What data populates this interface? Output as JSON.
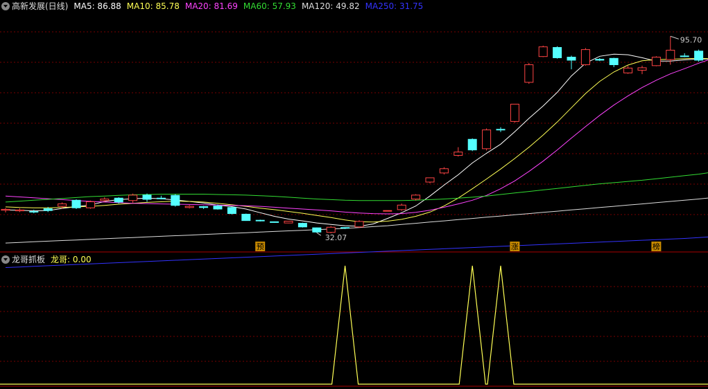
{
  "main_panel": {
    "title": "高新发展(日线)",
    "ma_legend": [
      {
        "label": "MA5: 86.88",
        "color": "#ffffff"
      },
      {
        "label": "MA10: 85.78",
        "color": "#ffff55"
      },
      {
        "label": "MA20: 81.69",
        "color": "#ff44ff"
      },
      {
        "label": "MA60: 57.93",
        "color": "#33dd33"
      },
      {
        "label": "MA120: 49.82",
        "color": "#dddddd"
      },
      {
        "label": "MA250: 31.75",
        "color": "#3333ff"
      }
    ],
    "high_label": "95.70",
    "low_label": "32.07",
    "markers": [
      "预",
      "涨",
      "榜"
    ]
  },
  "indicator_panel": {
    "title": "龙哥抓板",
    "value_label": "龙哥: 0.00"
  },
  "colors": {
    "up": "#ff4444",
    "down": "#55ffff",
    "grid": "#7a0000",
    "indicator_line": "#ffff55",
    "marker_bg": "#c88a00"
  },
  "chart_data": {
    "type": "candlestick",
    "price_range": [
      25,
      104
    ],
    "candles": [
      [
        38.3,
        38.6,
        37.6,
        39.0
      ],
      [
        38.1,
        38.4,
        37.7,
        38.9
      ],
      [
        37.9,
        37.8,
        37.3,
        38.5
      ],
      [
        38.8,
        38.2,
        37.7,
        39.4
      ],
      [
        39.6,
        40.4,
        38.8,
        40.9
      ],
      [
        41.6,
        39.1,
        38.7,
        41.9
      ],
      [
        39.1,
        41.1,
        38.8,
        41.5
      ],
      [
        41.5,
        42.0,
        41.1,
        42.6
      ],
      [
        42.3,
        41.0,
        40.5,
        42.6
      ],
      [
        41.5,
        43.3,
        40.8,
        43.8
      ],
      [
        43.3,
        41.9,
        41.1,
        43.8
      ],
      [
        42.3,
        42.2,
        41.9,
        43.1
      ],
      [
        43.2,
        39.9,
        39.5,
        43.6
      ],
      [
        39.2,
        39.6,
        38.9,
        40.0
      ],
      [
        39.5,
        39.2,
        38.7,
        39.7
      ],
      [
        39.7,
        38.7,
        38.5,
        40.2
      ],
      [
        39.2,
        37.2,
        36.9,
        39.4
      ],
      [
        37.0,
        34.9,
        34.8,
        37.2
      ],
      [
        35.0,
        34.8,
        34.6,
        35.2
      ],
      [
        34.5,
        34.3,
        34.2,
        34.6
      ],
      [
        34.1,
        34.7,
        34.0,
        34.8
      ],
      [
        34.0,
        32.8,
        32.6,
        34.2
      ],
      [
        32.5,
        31.1,
        30.9,
        32.6
      ],
      [
        31.0,
        32.7,
        30.7,
        33.1
      ],
      [
        32.6,
        32.4,
        32.1,
        32.7
      ],
      [
        32.8,
        34.6,
        32.5,
        35.0
      ],
      [
        null,
        null,
        null,
        null
      ],
      [
        38.2,
        38.2,
        38.2,
        38.2
      ],
      [
        38.5,
        40.0,
        38.1,
        40.5
      ],
      [
        42.0,
        43.3,
        41.5,
        43.6
      ],
      [
        47.6,
        49.0,
        47.2,
        49.0
      ],
      [
        50.6,
        52.0,
        50.1,
        52.5
      ],
      [
        56.4,
        57.5,
        56.0,
        59.1
      ],
      [
        61.7,
        58.2,
        57.8,
        62.0
      ],
      [
        58.6,
        64.8,
        58.0,
        65.3
      ],
      [
        65.0,
        64.8,
        64.1,
        65.7
      ],
      [
        67.6,
        73.3,
        67.2,
        73.4
      ],
      [
        80.5,
        86.3,
        80.0,
        86.9
      ],
      [
        89.0,
        92.2,
        88.8,
        92.6
      ],
      [
        92.0,
        88.6,
        88.3,
        92.4
      ],
      [
        88.8,
        87.8,
        84.8,
        89.3
      ],
      [
        86.3,
        91.3,
        86.0,
        91.8
      ],
      [
        88.1,
        87.8,
        87.5,
        88.5
      ],
      [
        88.4,
        86.3,
        85.5,
        88.6
      ],
      [
        83.6,
        85.2,
        83.3,
        85.9
      ],
      [
        84.5,
        85.3,
        83.2,
        86.0
      ],
      [
        86.0,
        88.8,
        85.8,
        89.1
      ],
      [
        88.0,
        91.1,
        86.3,
        95.7
      ],
      [
        89.2,
        89.0,
        88.8,
        90.1
      ],
      [
        90.8,
        87.8,
        87.3,
        91.3
      ],
      [
        88.0,
        88.0,
        87.5,
        88.9
      ]
    ],
    "ma_series": [
      {
        "name": "MA5",
        "color": "#ffffff",
        "values": [
          38.4,
          38.3,
          38.1,
          38.2,
          38.9,
          39.5,
          40.0,
          41.2,
          41.8,
          42.1,
          42.3,
          42.1,
          41.7,
          41.2,
          40.7,
          40.0,
          39.5,
          38.7,
          37.5,
          36.3,
          35.4,
          34.8,
          34.1,
          33.6,
          33.2,
          33.0,
          33.8,
          35.6,
          37.5,
          39.7,
          43.0,
          46.6,
          50.0,
          53.9,
          57.1,
          60.1,
          64.2,
          68.6,
          72.7,
          77.2,
          82.6,
          86.8,
          89.1,
          89.8,
          89.6,
          88.6,
          87.5,
          87.5,
          87.9,
          88.2,
          88.2
        ]
      },
      {
        "name": "MA10",
        "color": "#ffff55",
        "values": [
          39.4,
          39.2,
          39.1,
          39.1,
          39.2,
          39.4,
          39.6,
          39.9,
          40.3,
          40.6,
          40.9,
          41.1,
          41.3,
          41.2,
          41.0,
          40.6,
          40.1,
          39.6,
          39.0,
          38.5,
          37.9,
          37.3,
          36.6,
          35.9,
          35.1,
          34.5,
          34.4,
          34.7,
          35.3,
          36.3,
          37.7,
          39.7,
          42.3,
          45.4,
          48.6,
          51.9,
          55.4,
          59.1,
          63.1,
          67.4,
          72.1,
          76.8,
          80.8,
          83.9,
          86.2,
          87.6,
          88.0,
          88.1,
          88.3,
          88.4,
          88.3
        ]
      },
      {
        "name": "MA20",
        "color": "#ff44ff",
        "values": [
          43.0,
          42.7,
          42.4,
          42.1,
          41.8,
          41.5,
          41.2,
          41.0,
          40.8,
          40.6,
          40.5,
          40.4,
          40.3,
          40.2,
          40.1,
          40.0,
          39.9,
          39.8,
          39.6,
          39.3,
          39.0,
          38.7,
          38.4,
          38.1,
          37.7,
          37.4,
          37.2,
          37.1,
          37.2,
          37.6,
          38.3,
          39.3,
          40.4,
          41.6,
          43.2,
          45.4,
          48.0,
          51.1,
          54.5,
          58.2,
          62.1,
          65.9,
          69.6,
          73.0,
          76.0,
          78.8,
          81.2,
          83.3,
          85.0,
          86.8,
          88.4
        ]
      },
      {
        "name": "MA60",
        "color": "#33dd33",
        "values": [
          41.0,
          41.3,
          41.6,
          41.9,
          42.2,
          42.5,
          42.8,
          43.0,
          43.2,
          43.4,
          43.5,
          43.6,
          43.6,
          43.6,
          43.6,
          43.5,
          43.4,
          43.3,
          43.1,
          42.9,
          42.6,
          42.3,
          42.0,
          41.8,
          41.6,
          41.5,
          41.5,
          41.5,
          41.5,
          41.6,
          41.8,
          42.0,
          42.3,
          42.6,
          43.0,
          43.5,
          44.0,
          44.5,
          45.0,
          45.5,
          46.0,
          46.5,
          47.0,
          47.4,
          47.8,
          48.2,
          48.7,
          49.2,
          49.7,
          50.2,
          50.9
        ]
      },
      {
        "name": "MA120",
        "color": "#dddddd",
        "values": [
          27.5,
          27.7,
          27.9,
          28.1,
          28.3,
          28.5,
          28.7,
          28.9,
          29.1,
          29.3,
          29.5,
          29.7,
          29.9,
          30.1,
          30.3,
          30.5,
          30.7,
          30.9,
          31.1,
          31.3,
          31.5,
          31.7,
          31.9,
          32.1,
          32.3,
          32.6,
          32.9,
          33.2,
          33.6,
          34.0,
          34.4,
          34.8,
          35.2,
          35.6,
          36.0,
          36.4,
          36.8,
          37.2,
          37.6,
          38.0,
          38.4,
          38.8,
          39.2,
          39.6,
          40.0,
          40.4,
          40.8,
          41.2,
          41.6,
          42.0,
          42.5
        ]
      },
      {
        "name": "MA250",
        "color": "#3333ff",
        "values": [
          19.4,
          19.6,
          19.8,
          20.0,
          20.2,
          20.4,
          20.6,
          20.8,
          21.0,
          21.2,
          21.4,
          21.6,
          21.8,
          22.0,
          22.2,
          22.4,
          22.6,
          22.8,
          23.0,
          23.2,
          23.4,
          23.6,
          23.8,
          24.0,
          24.2,
          24.4,
          24.6,
          24.8,
          25.0,
          25.2,
          25.4,
          25.6,
          25.8,
          26.0,
          26.2,
          26.4,
          26.6,
          26.8,
          27.0,
          27.2,
          27.4,
          27.6,
          27.8,
          28.0,
          28.2,
          28.4,
          28.6,
          28.8,
          29.0,
          29.3,
          29.6
        ]
      }
    ],
    "marker_index": [
      18,
      36,
      46
    ],
    "high_index": 47,
    "low_index": 22,
    "indicator": {
      "name": "龙哥",
      "values": [
        0,
        0,
        0,
        0,
        0,
        0,
        0,
        0,
        0,
        0,
        0,
        0,
        0,
        0,
        0,
        0,
        0,
        0,
        0,
        0,
        0,
        0,
        0,
        0,
        1,
        0,
        0,
        0,
        0,
        0,
        0,
        0,
        0,
        1,
        0,
        1,
        0,
        0,
        0,
        0,
        0,
        0,
        0,
        0,
        0,
        0,
        0,
        0,
        0,
        0,
        0
      ],
      "range": [
        0,
        1
      ]
    }
  }
}
